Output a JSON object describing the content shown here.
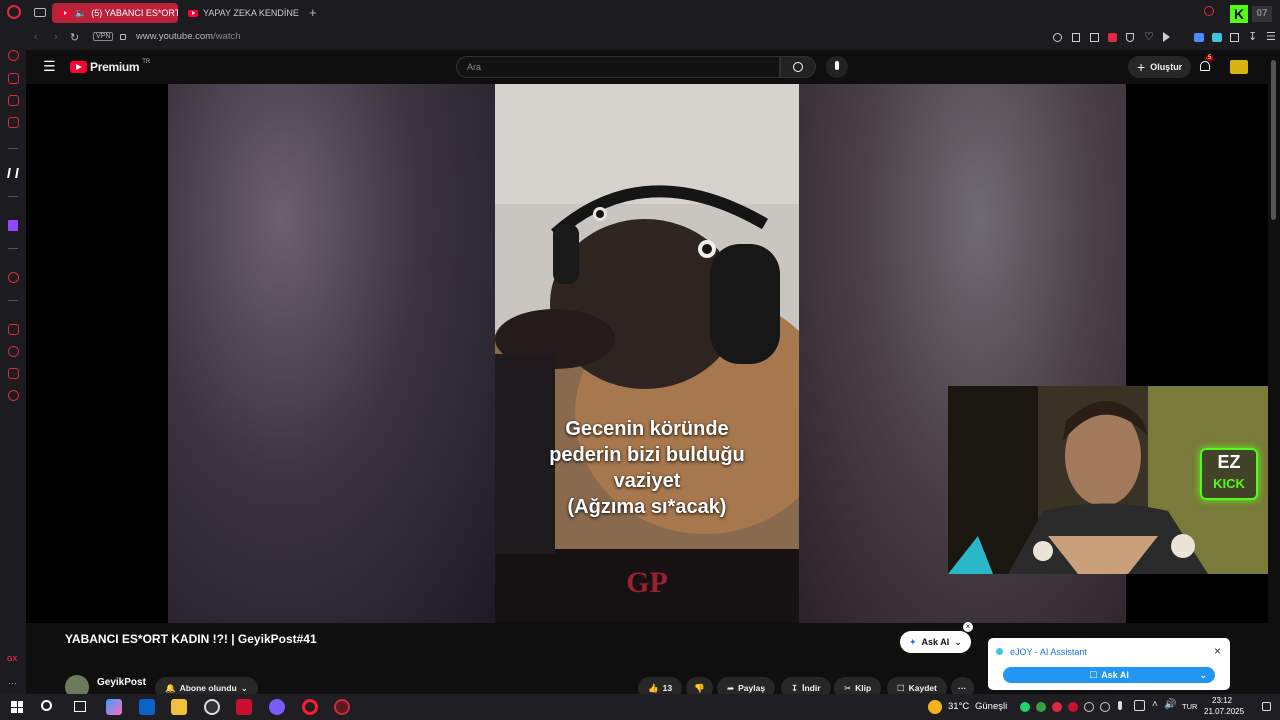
{
  "browser": {
    "tabs": [
      {
        "label": "(5) YABANCI ES*ORT",
        "active": true
      },
      {
        "label": "YAPAY ZEKA KENDİNE M",
        "active": false
      }
    ],
    "new_tab_symbol": "+",
    "vpn_label": "VPN",
    "url_host": "www.youtube.com",
    "url_path": "/watch"
  },
  "youtube": {
    "logo_text": "Premium",
    "logo_sup": "TR",
    "search_placeholder": "Ara",
    "create_label": "Oluştur",
    "notification_count": "5"
  },
  "video": {
    "caption_lines": [
      "Gecenin köründe",
      "pederin bizi bulduğu",
      "vaziyet",
      "(Ağzıma sı*acak)"
    ],
    "watermark": "GP",
    "title": "YABANCI ES*ORT KADIN !?! | GeyikPost#41",
    "channel_name": "GeyikPost",
    "subscribe_label": "Abone olundu",
    "ask_ai_label": "Ask AI",
    "like_count": "13",
    "share_label": "Paylaş",
    "download_label": "İndir",
    "clip_label": "Klip",
    "save_label": "Kaydet"
  },
  "webcam": {
    "badge_top": "EZ",
    "badge_bottom": "KICK"
  },
  "ejoy": {
    "title": "eJOY - AI Assistant",
    "button_label": "Ask AI"
  },
  "sidebar_bottom_label": "GX",
  "taskbar": {
    "weather_temp": "31°C",
    "weather_desc": "Güneşli",
    "language": "TUR",
    "time": "23:12",
    "date": "21.07.2025"
  },
  "colors": {
    "accent_red": "#e0283f",
    "youtube_red": "#ff0033",
    "ejoy_blue": "#1a73e8",
    "kick_green": "#53fc18"
  }
}
